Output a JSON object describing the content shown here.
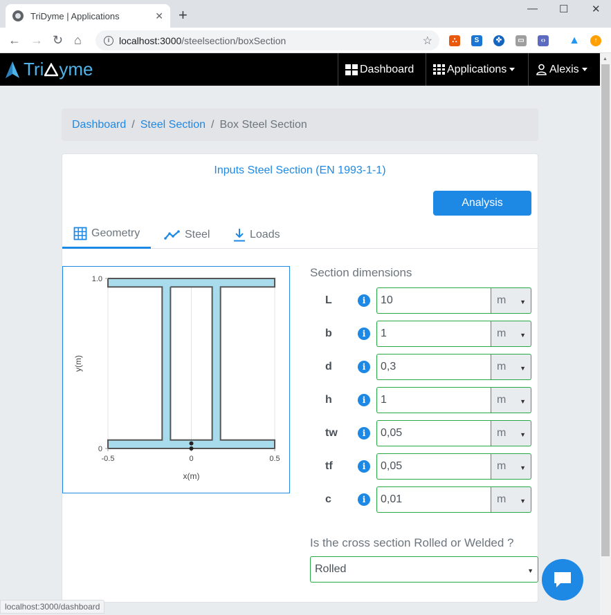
{
  "browser": {
    "tab_title": "TriDyme | Applications",
    "url_host": "localhost:3000",
    "url_path": "/steelsection/boxSection",
    "status_url": "localhost:3000/dashboard"
  },
  "navbar": {
    "brand_pre": "Tri",
    "brand_post": "yme",
    "dashboard": "Dashboard",
    "applications": "Applications",
    "user": "Alexis"
  },
  "breadcrumb": {
    "items": [
      "Dashboard",
      "Steel Section"
    ],
    "active": "Box Steel Section",
    "separator": "/"
  },
  "card": {
    "title": "Inputs Steel Section (EN 1993-1-1)",
    "analysis_button": "Analysis",
    "tabs": [
      "Geometry",
      "Steel",
      "Loads"
    ]
  },
  "form": {
    "section_heading": "Section dimensions",
    "dimensions": [
      {
        "label": "L",
        "value": "10",
        "unit": "m"
      },
      {
        "label": "b",
        "value": "1",
        "unit": "m"
      },
      {
        "label": "d",
        "value": "0,3",
        "unit": "m"
      },
      {
        "label": "h",
        "value": "1",
        "unit": "m"
      },
      {
        "label": "tw",
        "value": "0,05",
        "unit": "m"
      },
      {
        "label": "tf",
        "value": "0,05",
        "unit": "m"
      },
      {
        "label": "c",
        "value": "0,01",
        "unit": "m"
      }
    ],
    "info_glyph": "i",
    "rolled_question": "Is the cross section Rolled or Welded ?",
    "rolled_value": "Rolled"
  },
  "chart_data": {
    "type": "line",
    "xlabel": "x(m)",
    "ylabel": "y(m)",
    "xlim": [
      -0.5,
      0.5
    ],
    "ylim": [
      0,
      1
    ],
    "xticks": [
      "-0.5",
      "0",
      "0.5"
    ],
    "yticks": [
      "0",
      "1.0"
    ],
    "grid": true,
    "fill_color": "#a8dcec",
    "stroke_color": "#555555",
    "series": [
      {
        "values": [
          [
            -0.5,
            1.0
          ],
          [
            0.5,
            1.0
          ],
          [
            0.5,
            0.95
          ],
          [
            0.175,
            0.95
          ],
          [
            0.175,
            0.05
          ],
          [
            0.5,
            0.05
          ],
          [
            0.5,
            0.0
          ],
          [
            -0.5,
            0.0
          ],
          [
            -0.5,
            0.05
          ],
          [
            -0.175,
            0.05
          ],
          [
            -0.175,
            0.95
          ],
          [
            -0.5,
            0.95
          ],
          [
            -0.5,
            1.0
          ]
        ]
      },
      {
        "values": [
          [
            -0.125,
            0.95
          ],
          [
            0.125,
            0.95
          ],
          [
            0.125,
            0.05
          ],
          [
            -0.125,
            0.05
          ],
          [
            -0.125,
            0.95
          ]
        ]
      }
    ],
    "points": [
      [
        0,
        0.03
      ],
      [
        0,
        0.0
      ]
    ]
  },
  "colors": {
    "accent": "#1e88e5",
    "valid": "#28a745",
    "navbar": "#000000",
    "brand": "#4fb3e8"
  }
}
